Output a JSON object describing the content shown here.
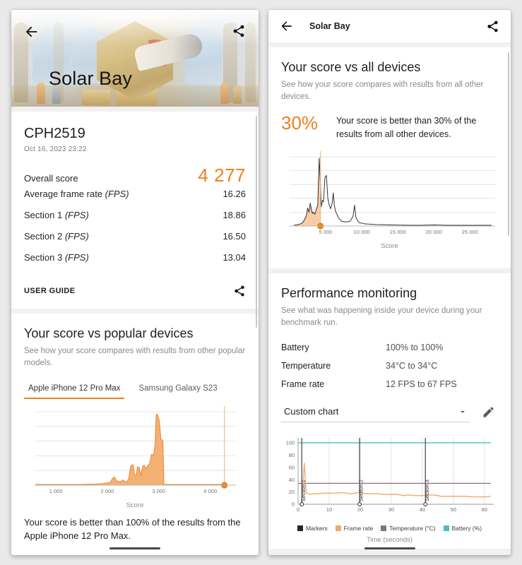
{
  "left_panel": {
    "hero": {
      "title": "Solar Bay",
      "back_icon": "back-arrow-icon",
      "share_icon": "share-icon"
    },
    "result": {
      "device": "CPH2519",
      "timestamp": "Oct 16, 2023 23:22",
      "rows": [
        {
          "label": "Overall score",
          "italic": "",
          "value": "4 277",
          "highlight": true
        },
        {
          "label": "Average frame rate ",
          "italic": "(FPS)",
          "value": "16.26",
          "highlight": false
        },
        {
          "label": "Section 1 ",
          "italic": "(FPS)",
          "value": "18.86",
          "highlight": false
        },
        {
          "label": "Section 2 ",
          "italic": "(FPS)",
          "value": "16.50",
          "highlight": false
        },
        {
          "label": "Section 3 ",
          "italic": "(FPS)",
          "value": "13.04",
          "highlight": false
        }
      ],
      "user_guide_label": "USER GUIDE",
      "share_icon": "share-icon"
    },
    "popular": {
      "title": "Your score vs popular devices",
      "subtitle": "See how your score compares with results from other popular models.",
      "tabs": [
        {
          "label": "Apple iPhone 12 Pro Max",
          "active": true
        },
        {
          "label": "Samsung Galaxy S23",
          "active": false
        }
      ],
      "note": "Your score is better than 100% of the results from the Apple iPhone 12 Pro Max."
    }
  },
  "right_panel": {
    "appbar": {
      "title": "Solar Bay",
      "back_icon": "back-arrow-icon",
      "share_icon": "share-icon"
    },
    "all_devices": {
      "title": "Your score vs all devices",
      "subtitle": "See how your score compares with results from all other devices.",
      "percent": "30%",
      "percent_text": "Your score is better than 30% of the results from all other devices."
    },
    "performance": {
      "title": "Performance monitoring",
      "subtitle": "See what was happening inside your device during your benchmark run.",
      "stats": [
        {
          "key": "Battery",
          "value": "100% to 100%"
        },
        {
          "key": "Temperature",
          "value": "34°C to 34°C"
        },
        {
          "key": "Frame rate",
          "value": "12 FPS to 67 FPS"
        }
      ],
      "chart_select": {
        "value": "Custom chart",
        "caret_icon": "chevron-down-icon"
      },
      "edit_icon": "pencil-icon"
    }
  },
  "colors": {
    "accent": "#e8821e",
    "fill": "#f2a35d",
    "markers": "#262626",
    "frame_rate": "#f0a868",
    "temperature": "#8e6f7e",
    "battery": "#4bbfc0"
  },
  "chart_data": [
    {
      "id": "popular-devices-distribution",
      "type": "area",
      "title": "Your score vs popular devices",
      "xlabel": "Score",
      "ylabel": "",
      "xlim": [
        600,
        4500
      ],
      "ylim": [
        0,
        100
      ],
      "xticks": [
        1000,
        2000,
        3000,
        4000
      ],
      "xticklabels": [
        "1 000",
        "2 000",
        "3 000",
        "4 000"
      ],
      "gridlines_y": 6,
      "marker": {
        "x": 4277,
        "y": 0,
        "label": "4 277",
        "color": "#e8821e"
      },
      "x": [
        600,
        900,
        1200,
        1500,
        1750,
        1900,
        2000,
        2060,
        2100,
        2140,
        2180,
        2220,
        2260,
        2300,
        2340,
        2380,
        2420,
        2450,
        2470,
        2500,
        2530,
        2560,
        2590,
        2620,
        2650,
        2690,
        2720,
        2750,
        2790,
        2820,
        2860,
        2900,
        2930,
        2950,
        2970,
        2990,
        3010,
        3040,
        3060,
        3080,
        3090,
        3100,
        3150,
        3400,
        3800,
        4277
      ],
      "y": [
        1,
        1,
        1,
        1,
        1.5,
        2,
        3,
        4,
        9,
        11,
        6,
        5,
        5,
        7,
        5,
        4,
        10,
        25,
        27,
        28,
        14,
        13,
        25,
        24,
        13,
        26,
        27,
        22,
        27,
        29,
        42,
        41,
        56,
        95,
        97,
        92,
        88,
        63,
        62,
        60,
        30,
        1,
        1,
        1,
        1,
        1
      ]
    },
    {
      "id": "all-devices-distribution",
      "type": "area",
      "title": "Your score vs all devices",
      "xlabel": "Score",
      "ylabel": "",
      "xlim": [
        0,
        28500
      ],
      "ylim": [
        0,
        100
      ],
      "xticks": [
        5000,
        10000,
        15000,
        20000,
        25000
      ],
      "xticklabels": [
        "5 000",
        "10 000",
        "15 000",
        "20 000",
        "25 000"
      ],
      "gridlines_y": 6,
      "marker": {
        "x": 4277,
        "y": 0,
        "label": "4 277",
        "color": "#e8821e"
      },
      "x": [
        600,
        1200,
        1700,
        2000,
        2300,
        2500,
        2700,
        2850,
        3000,
        3150,
        3300,
        3500,
        3700,
        3900,
        4100,
        4277,
        4400,
        4550,
        4700,
        4900,
        5100,
        5300,
        5500,
        5700,
        5900,
        6050,
        6200,
        6350,
        6500,
        6700,
        6900,
        7200,
        7600,
        8000,
        8400,
        8800,
        9000,
        9200,
        9600,
        10500,
        12000,
        14000,
        16000,
        18000,
        20000,
        22000,
        24000,
        26000,
        28000
      ],
      "y": [
        1,
        2,
        4,
        8,
        14,
        26,
        20,
        33,
        26,
        18,
        20,
        17,
        24,
        30,
        98,
        60,
        28,
        37,
        35,
        70,
        73,
        40,
        30,
        25,
        33,
        48,
        30,
        22,
        18,
        14,
        10,
        7,
        6,
        6,
        7,
        14,
        30,
        12,
        5,
        3,
        2,
        1.5,
        1.2,
        1,
        1.5,
        1,
        1,
        1,
        1
      ]
    },
    {
      "id": "performance-monitoring-custom-chart",
      "type": "line",
      "title": "Custom chart",
      "xlabel": "Time (seconds)",
      "ylabel": "",
      "xlim": [
        0,
        63
      ],
      "ylim": [
        0,
        108
      ],
      "xticks": [
        0,
        10,
        20,
        30,
        40,
        50,
        60
      ],
      "yticks": [
        0,
        20,
        40,
        60,
        80,
        100
      ],
      "legend_position": "bottom",
      "legend": [
        "Markers",
        "Frame rate",
        "Temperature (°C)",
        "Battery (%)"
      ],
      "markers": [
        {
          "label": "Section 1",
          "x": 1.2
        },
        {
          "label": "Section 2",
          "x": 19.8
        },
        {
          "label": "Section 3",
          "x": 41.0
        }
      ],
      "series": [
        {
          "name": "Battery (%)",
          "color": "#4bbfc0",
          "x": [
            0,
            62
          ],
          "values": [
            100,
            100
          ]
        },
        {
          "name": "Temperature (°C)",
          "color": "#8e6f7e",
          "x": [
            0,
            62
          ],
          "values": [
            34,
            34
          ]
        },
        {
          "name": "Frame rate",
          "color": "#f0a868",
          "x": [
            1.0,
            1.5,
            2.0,
            2.3,
            2.6,
            3,
            4,
            5,
            6,
            8,
            10,
            12,
            14,
            16,
            17,
            18,
            19,
            20,
            21,
            22,
            24,
            26,
            28,
            30,
            32,
            33,
            34,
            35,
            36,
            38,
            40,
            42,
            44,
            45,
            46,
            48,
            50,
            52,
            54,
            56,
            58,
            60,
            62
          ],
          "values": [
            0,
            30,
            67,
            40,
            20,
            17,
            16,
            17,
            17,
            18,
            18,
            18,
            19,
            18,
            17,
            18,
            19,
            19,
            18,
            17,
            17,
            17,
            16,
            16,
            16,
            15,
            14,
            15,
            15,
            14,
            14,
            15,
            15,
            14,
            13,
            13,
            13,
            13,
            13,
            12,
            12,
            12,
            13
          ]
        }
      ]
    }
  ]
}
